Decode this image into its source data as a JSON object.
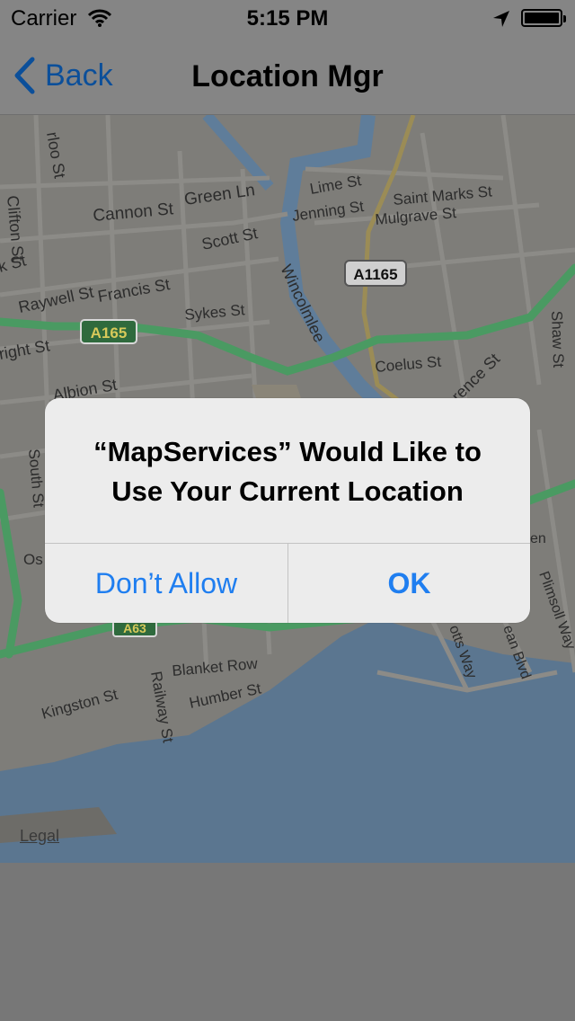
{
  "status_bar": {
    "carrier": "Carrier",
    "time": "5:15 PM"
  },
  "nav_bar": {
    "back_label": "Back",
    "title": "Location Mgr"
  },
  "map": {
    "legal_link": "Legal",
    "road_badges": [
      "A165",
      "A1165",
      "A63"
    ],
    "street_labels": [
      "rloo St",
      "Clifton St",
      "k St",
      "Raywell St",
      "Francis St",
      "Cannon St",
      "Green Ln",
      "Scott St",
      "Lime St",
      "Jenning St",
      "Saint Marks St",
      "Mulgrave St",
      "Sykes St",
      "Wincolmlee",
      "Coelus St",
      "rence St",
      "Shaw St",
      "right St",
      "Albion St",
      "South St",
      "Os",
      "Blanket Row",
      "Humber St",
      "Kingston St",
      "Railway St",
      "Plimsoll Way",
      "otts Way",
      "ean Blvd",
      "en"
    ],
    "colors": {
      "land": "#7e7d79",
      "water": "#5b7690",
      "major_road": "#4a9a62",
      "minor_road": "#8c8b87",
      "river": "#5f7d9a"
    }
  },
  "alert": {
    "message_line1": "“MapServices” Would Like to",
    "message_line2": "Use Your Current Location",
    "dont_allow_label": "Don’t Allow",
    "ok_label": "OK",
    "button_color": "#1f7ef0"
  }
}
